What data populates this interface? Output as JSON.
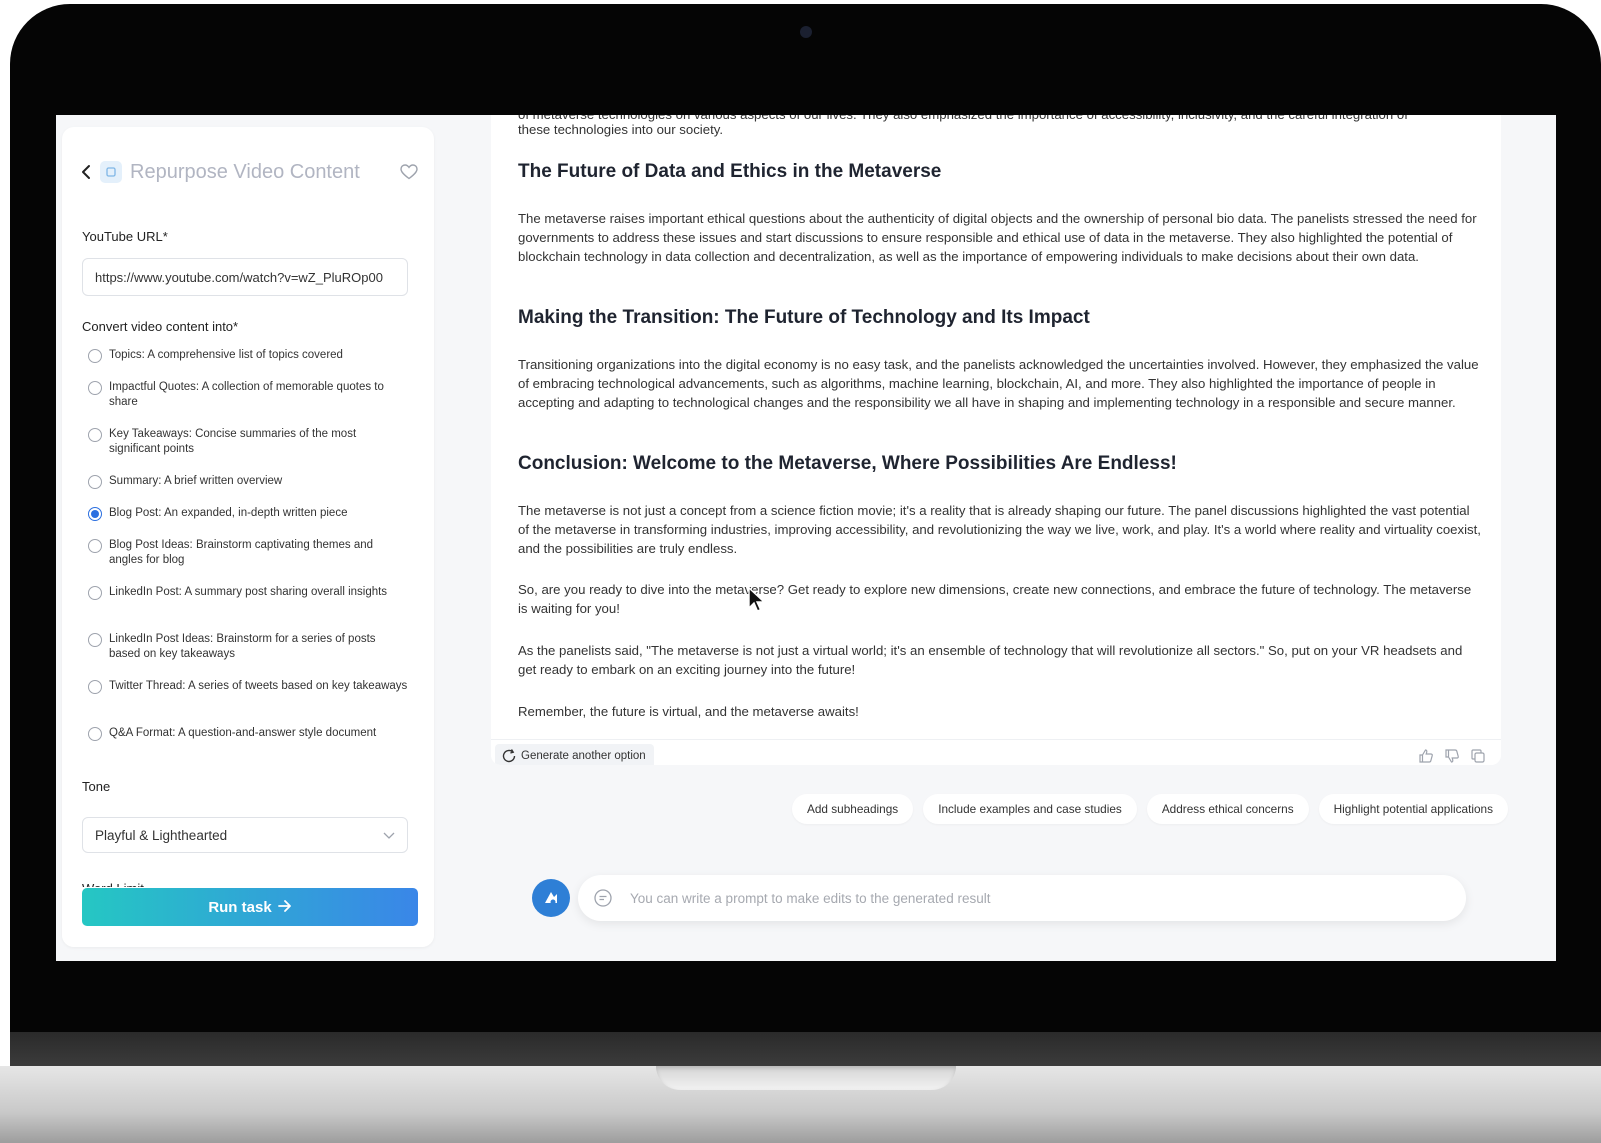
{
  "sidebar": {
    "title": "Repurpose Video Content",
    "youtube_url_label": "YouTube URL*",
    "youtube_url_value": "https://www.youtube.com/watch?v=wZ_PluROp00",
    "convert_label": "Convert video content into*",
    "options": [
      {
        "label": "Topics: A comprehensive list of topics covered",
        "checked": false
      },
      {
        "label": "Impactful Quotes: A collection of memorable quotes to share",
        "checked": false
      },
      {
        "label": "Key Takeaways: Concise summaries of the most significant points",
        "checked": false
      },
      {
        "label": "Summary: A brief written overview",
        "checked": false
      },
      {
        "label": "Blog Post: An expanded, in-depth written piece",
        "checked": true
      },
      {
        "label": "Blog Post Ideas: Brainstorm captivating themes and angles for blog",
        "checked": false
      },
      {
        "label": "LinkedIn Post: A summary post sharing overall insights",
        "checked": false
      },
      {
        "label": "LinkedIn Post Ideas: Brainstorm for a series of posts based on key takeaways",
        "checked": false
      },
      {
        "label": "Twitter Thread: A series of tweets based on key takeaways",
        "checked": false
      },
      {
        "label": "Q&A Format: A question-and-answer style document",
        "checked": false
      }
    ],
    "tone_label": "Tone",
    "tone_value": "Playful & Lighthearted",
    "word_limit_label": "Word Limit",
    "run_label": "Run task"
  },
  "article": {
    "cut_top": "of metaverse technologies on various aspects of our lives. They also emphasized the importance of accessibility, inclusivity, and the careful integration of",
    "cut_top_2": "these technologies into our society.",
    "sections": [
      {
        "heading": "The Future of Data and Ethics in the Metaverse",
        "paragraphs": [
          "The metaverse raises important ethical questions about the authenticity of digital objects and the ownership of personal bio data. The panelists stressed the need for governments to address these issues and start discussions to ensure responsible and ethical use of data in the metaverse. They also highlighted the potential of blockchain technology in data collection and decentralization, as well as the importance of empowering individuals to make decisions about their own data."
        ]
      },
      {
        "heading": "Making the Transition: The Future of Technology and Its Impact",
        "paragraphs": [
          "Transitioning organizations into the digital economy is no easy task, and the panelists acknowledged the uncertainties involved. However, they emphasized the value of embracing technological advancements, such as algorithms, machine learning, blockchain, AI, and more. They also highlighted the importance of people in accepting and adapting to technological changes and the responsibility we all have in shaping and implementing technology in a responsible and secure manner."
        ]
      },
      {
        "heading": "Conclusion: Welcome to the Metaverse, Where Possibilities Are Endless!",
        "paragraphs": [
          "The metaverse is not just a concept from a science fiction movie; it's a reality that is already shaping our future. The panel discussions highlighted the vast potential of the metaverse in transforming industries, improving accessibility, and revolutionizing the way we live, work, and play. It's a world where reality and virtuality coexist, and the possibilities are truly endless.",
          "So, are you ready to dive into the metaverse? Get ready to explore new dimensions, create new connections, and embrace the future of technology. The metaverse is waiting for you!",
          "As the panelists said, \"The metaverse is not just a virtual world; it's an ensemble of technology that will revolutionize all sectors.\" So, put on your VR headsets and get ready to embark on an exciting journey into the future!",
          "Remember, the future is virtual, and the metaverse awaits!"
        ]
      }
    ]
  },
  "actions": {
    "regenerate_label": "Generate another option",
    "suggestions": [
      "Add subheadings",
      "Include examples and case studies",
      "Address ethical concerns",
      "Highlight potential applications"
    ],
    "prompt_placeholder": "You can write a prompt to make edits to the generated result"
  },
  "colors": {
    "accent": "#2b6fe0",
    "run_gradient_start": "#25c7c3",
    "run_gradient_end": "#3a86e8",
    "avatar": "#2e7fd6"
  },
  "icons": [
    "back-icon",
    "app-icon",
    "heart-icon",
    "refresh-icon",
    "thumbs-up-icon",
    "thumbs-down-icon",
    "copy-icon",
    "chat-icon",
    "chevron-down-icon",
    "arrow-right-icon"
  ]
}
